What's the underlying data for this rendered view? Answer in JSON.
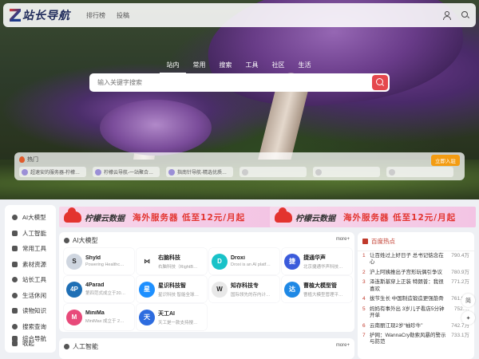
{
  "header": {
    "logo_text": "站长导航",
    "nav": [
      "排行榜",
      "投稿"
    ]
  },
  "search": {
    "tabs": [
      "站内",
      "常用",
      "搜索",
      "工具",
      "社区",
      "生活"
    ],
    "active_tab": 0,
    "placeholder": "输入关键字搜索"
  },
  "hot": {
    "title": "热门",
    "button": "立即入驻",
    "items": [
      "超速安的服务器-柠檬…",
      "柠檬云导航-一站聚合…",
      "指南针导航-精选优质…",
      "",
      "",
      ""
    ]
  },
  "sidebar": {
    "items": [
      "AI大模型",
      "人工智能",
      "常用工具",
      "素材资源",
      "站长工具",
      "生活休闲",
      "读物知识",
      "搜索查询",
      "综合导航"
    ],
    "collapse": "收起"
  },
  "banners": [
    {
      "brand": "柠檬云数据",
      "message": "海外服务器 低至12元/月起"
    },
    {
      "brand": "柠檬云数据",
      "message": "海外服务器 低至12元/月起"
    }
  ],
  "section_ai": {
    "title": "AI大模型",
    "more": "more+",
    "cards": [
      {
        "name": "Shyld",
        "desc": "Powering Healthc…",
        "color": "#cfd6e0",
        "glyph": "S"
      },
      {
        "name": "右脑科技",
        "desc": "右脑科技（RightB…",
        "color": "#ffffff",
        "glyph": "⋈"
      },
      {
        "name": "Droxi",
        "desc": "Droxi is an AI platf…",
        "color": "#19c2c8",
        "glyph": "D"
      },
      {
        "name": "捷通华声",
        "desc": "北京捷通华声科技…",
        "color": "#3b5bdb",
        "glyph": "捷"
      },
      {
        "name": "4Parad",
        "desc": "第四范式成立于20…",
        "color": "#1f6fb5",
        "glyph": "4P"
      },
      {
        "name": "星识科技智",
        "desc": "星识科技 智能全球…",
        "color": "#1e90ff",
        "glyph": "星"
      },
      {
        "name": "知存科技专",
        "desc": "国际领先的存内计…",
        "color": "#e8e8e8",
        "glyph": "W"
      },
      {
        "name": "曹植大模型管",
        "desc": "曹植大模型管理平…",
        "color": "#1e88e5",
        "glyph": "达"
      },
      {
        "name": "MiniMa",
        "desc": "MiniMax 成立于 2…",
        "color": "#e84a7a",
        "glyph": "M"
      },
      {
        "name": "天工AI",
        "desc": "天工是一款支持搜…",
        "color": "#2d6cdf",
        "glyph": "天"
      }
    ]
  },
  "section_ai2": {
    "title": "人工智能",
    "more": "more+"
  },
  "news": {
    "title": "百度热点",
    "items": [
      {
        "rank": "1",
        "title": "让百姓过上好日子 总书记惦念在心",
        "count": "790.4万"
      },
      {
        "rank": "2",
        "title": "沪上阿姨推出子宫形玩偶引争议",
        "count": "780.9万"
      },
      {
        "rank": "3",
        "title": "泽连斯基穿上正装 特朗普：我很喜欢",
        "count": "771.2万"
      },
      {
        "rank": "4",
        "title": "拔节生长 中国制造锻造更强筋骨",
        "count": "761.9万"
      },
      {
        "rank": "5",
        "title": "妈妈有事外出 3岁儿子看店5分钟开单",
        "count": "752.…"
      },
      {
        "rank": "6",
        "title": "云南丽江现2岁“袖珍牛”",
        "count": "742.7万"
      },
      {
        "rank": "7",
        "title": "护网：WannaCry勒索风暴的警示与防范",
        "count": "733.1万"
      }
    ]
  },
  "float": {
    "label": "简"
  }
}
